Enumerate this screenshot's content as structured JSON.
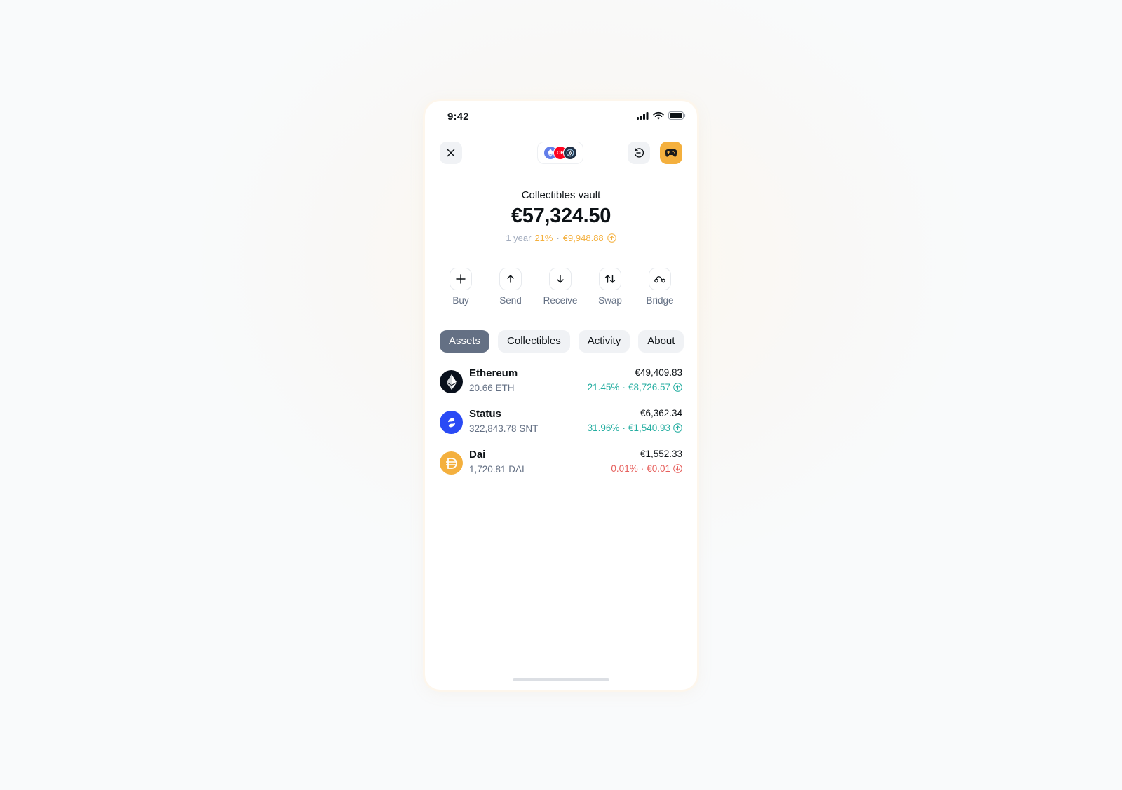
{
  "status_bar": {
    "time": "9:42"
  },
  "header": {
    "close_icon": "close-icon",
    "network_icons": [
      "ethereum-network-icon",
      "optimism-network-icon",
      "arbitrum-network-icon"
    ],
    "network_badge_text": "OP",
    "history_icon": "history-icon",
    "avatar_icon": "gamepad-icon"
  },
  "account": {
    "name": "Collectibles vault",
    "balance": "€57,324.50",
    "period": "1 year",
    "change_percent": "21%",
    "change_amount": "€9,948.88",
    "change_direction": "up"
  },
  "actions": [
    {
      "label": "Buy",
      "icon": "plus-icon"
    },
    {
      "label": "Send",
      "icon": "arrow-up-icon"
    },
    {
      "label": "Receive",
      "icon": "arrow-down-icon"
    },
    {
      "label": "Swap",
      "icon": "swap-icon"
    },
    {
      "label": "Bridge",
      "icon": "bridge-icon"
    }
  ],
  "tabs": [
    {
      "label": "Assets",
      "active": true
    },
    {
      "label": "Collectibles",
      "active": false
    },
    {
      "label": "Activity",
      "active": false
    },
    {
      "label": "About",
      "active": false
    }
  ],
  "assets": [
    {
      "name": "Ethereum",
      "amount": "20.66 ETH",
      "value": "€49,409.83",
      "change_percent": "21.45%",
      "change_amount": "€8,726.57",
      "direction": "up",
      "icon": "ethereum-icon",
      "color": "#09101c"
    },
    {
      "name": "Status",
      "amount": "322,843.78 SNT",
      "value": "€6,362.34",
      "change_percent": "31.96%",
      "change_amount": "€1,540.93",
      "direction": "up",
      "icon": "status-icon",
      "color": "#2a4af5"
    },
    {
      "name": "Dai",
      "amount": "1,720.81 DAI",
      "value": "€1,552.33",
      "change_percent": "0.01%",
      "change_amount": "€0.01",
      "direction": "down",
      "icon": "dai-icon",
      "color": "#f4b03e"
    }
  ],
  "colors": {
    "positive": "#23ada0",
    "negative": "#e65f5c",
    "accent": "#f4b03e",
    "tab_active": "#647084"
  }
}
